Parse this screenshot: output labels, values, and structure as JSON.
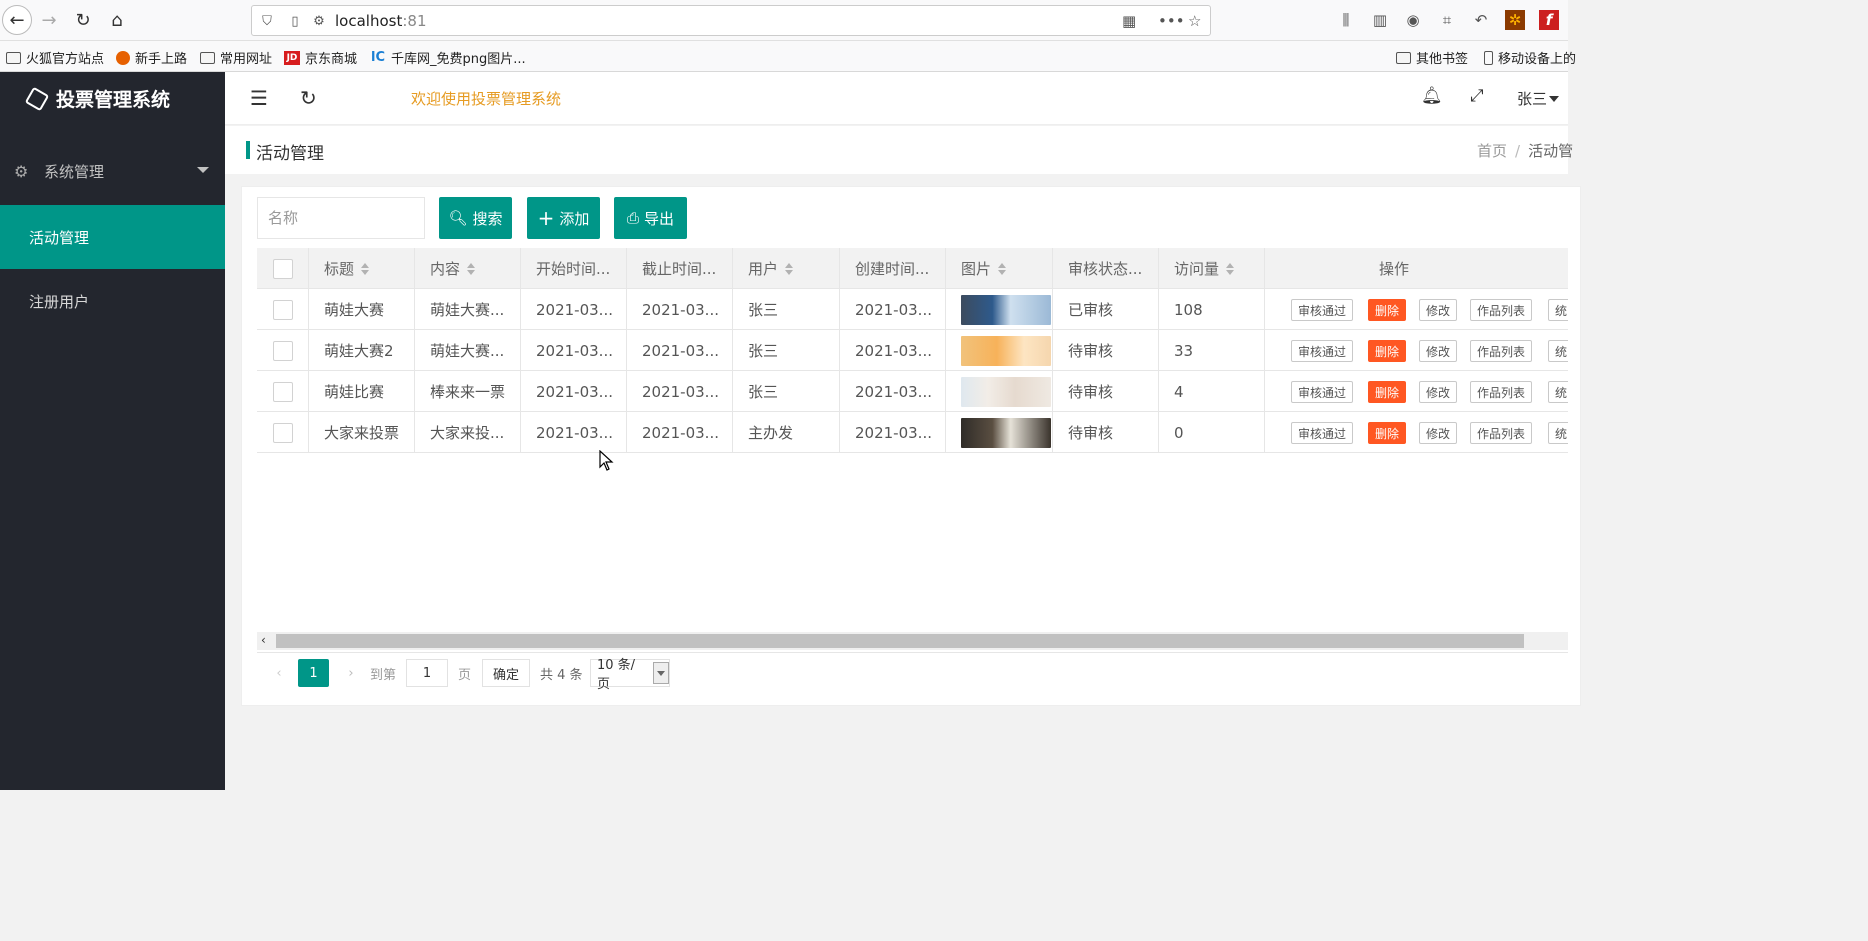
{
  "browser": {
    "url_host": "localhost",
    "url_port": ":81",
    "bookmarks": [
      "火狐官方站点",
      "新手上路",
      "常用网址",
      "京东商城",
      "千库网_免费png图片...",
      "其他书签",
      "移动设备上的"
    ]
  },
  "app": {
    "title": "投票管理系统",
    "welcome": "欢迎使用投票管理系统",
    "user": "张三"
  },
  "sidebar": {
    "group": "系统管理",
    "items": [
      {
        "label": "活动管理",
        "active": true
      },
      {
        "label": "注册用户",
        "active": false
      }
    ]
  },
  "page": {
    "title": "活动管理",
    "breadcrumb": [
      "首页",
      "/",
      "活动管"
    ]
  },
  "toolbar": {
    "search_placeholder": "名称",
    "search_label": "搜索",
    "add_label": "添加",
    "export_label": "导出"
  },
  "table": {
    "columns": [
      "标题",
      "内容",
      "开始时间...",
      "截止时间...",
      "用户",
      "创建时间...",
      "图片",
      "审核状态...",
      "访问量",
      "操作"
    ],
    "rows": [
      {
        "title": "萌娃大赛",
        "content": "萌娃大赛...",
        "start": "2021-03...",
        "end": "2021-03...",
        "user": "张三",
        "created": "2021-03...",
        "status": "已审核",
        "visits": "108",
        "thumb": "blue"
      },
      {
        "title": "萌娃大赛2",
        "content": "萌娃大赛...",
        "start": "2021-03...",
        "end": "2021-03...",
        "user": "张三",
        "created": "2021-03...",
        "status": "待审核",
        "visits": "33",
        "thumb": "orange"
      },
      {
        "title": "萌娃比赛",
        "content": "棒来来一票",
        "start": "2021-03...",
        "end": "2021-03...",
        "user": "张三",
        "created": "2021-03...",
        "status": "待审核",
        "visits": "4",
        "thumb": "light"
      },
      {
        "title": "大家来投票",
        "content": "大家来投...",
        "start": "2021-03...",
        "end": "2021-03...",
        "user": "主办发",
        "created": "2021-03...",
        "status": "待审核",
        "visits": "0",
        "thumb": "dark"
      }
    ],
    "actions": [
      "审核通过",
      "删除",
      "修改",
      "作品列表",
      "统"
    ]
  },
  "pagination": {
    "current": "1",
    "goto_label": "到第",
    "goto_value": "1",
    "page_label": "页",
    "confirm_label": "确定",
    "total_label": "共 4 条",
    "page_size": "10 条/页"
  },
  "colors": {
    "primary": "#009688",
    "danger": "#ff5722",
    "sidebar": "#23262e",
    "welcome": "#e69b22"
  }
}
